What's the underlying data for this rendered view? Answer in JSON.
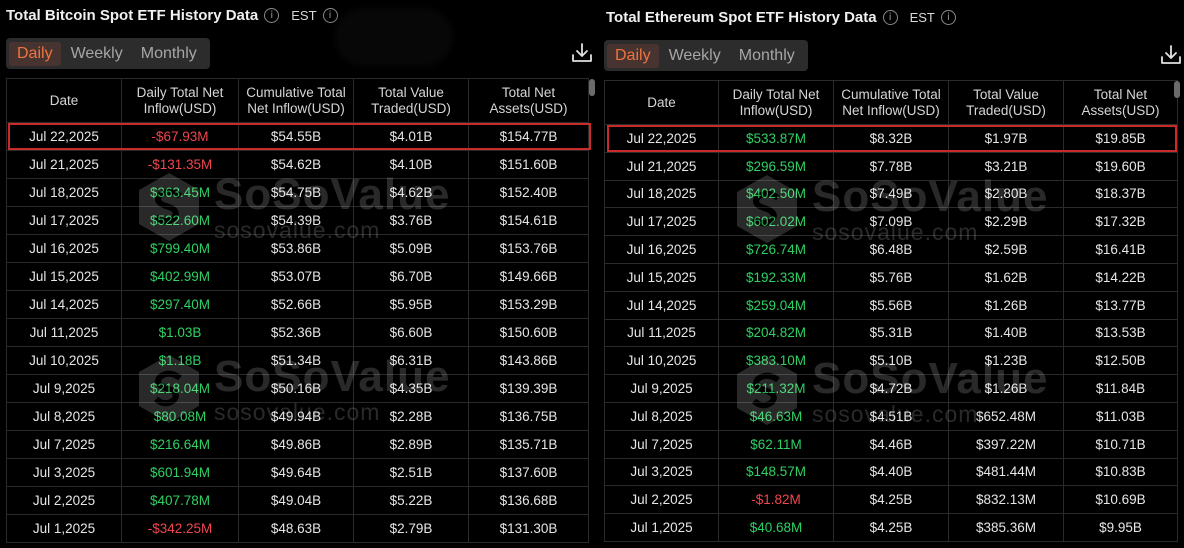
{
  "btc": {
    "title": "Total Bitcoin Spot ETF History Data",
    "timezone": "EST",
    "tabs": [
      "Daily",
      "Weekly",
      "Monthly"
    ],
    "active_tab": "Daily",
    "headers": [
      [
        "Date"
      ],
      [
        "Daily Total Net",
        "Inflow(USD)"
      ],
      [
        "Cumulative Total",
        "Net Inflow(USD)"
      ],
      [
        "Total Value",
        "Traded(USD)"
      ],
      [
        "Total Net",
        "Assets(USD)"
      ]
    ],
    "rows": [
      [
        "Jul 22,2025",
        "-$67.93M",
        "$54.55B",
        "$4.01B",
        "$154.77B"
      ],
      [
        "Jul 21,2025",
        "-$131.35M",
        "$54.62B",
        "$4.10B",
        "$151.60B"
      ],
      [
        "Jul 18,2025",
        "$363.45M",
        "$54.75B",
        "$4.62B",
        "$152.40B"
      ],
      [
        "Jul 17,2025",
        "$522.60M",
        "$54.39B",
        "$3.76B",
        "$154.61B"
      ],
      [
        "Jul 16,2025",
        "$799.40M",
        "$53.86B",
        "$5.09B",
        "$153.76B"
      ],
      [
        "Jul 15,2025",
        "$402.99M",
        "$53.07B",
        "$6.70B",
        "$149.66B"
      ],
      [
        "Jul 14,2025",
        "$297.40M",
        "$52.66B",
        "$5.95B",
        "$153.29B"
      ],
      [
        "Jul 11,2025",
        "$1.03B",
        "$52.36B",
        "$6.60B",
        "$150.60B"
      ],
      [
        "Jul 10,2025",
        "$1.18B",
        "$51.34B",
        "$6.31B",
        "$143.86B"
      ],
      [
        "Jul 9,2025",
        "$218.04M",
        "$50.16B",
        "$4.35B",
        "$139.39B"
      ],
      [
        "Jul 8,2025",
        "$80.08M",
        "$49.94B",
        "$2.28B",
        "$136.75B"
      ],
      [
        "Jul 7,2025",
        "$216.64M",
        "$49.86B",
        "$2.89B",
        "$135.71B"
      ],
      [
        "Jul 3,2025",
        "$601.94M",
        "$49.64B",
        "$2.51B",
        "$137.60B"
      ],
      [
        "Jul 2,2025",
        "$407.78M",
        "$49.04B",
        "$5.22B",
        "$136.68B"
      ],
      [
        "Jul 1,2025",
        "-$342.25M",
        "$48.63B",
        "$2.79B",
        "$131.30B"
      ]
    ]
  },
  "eth": {
    "title": "Total Ethereum Spot ETF History Data",
    "timezone": "EST",
    "tabs": [
      "Daily",
      "Weekly",
      "Monthly"
    ],
    "active_tab": "Daily",
    "headers": [
      [
        "Date"
      ],
      [
        "Daily Total Net",
        "Inflow(USD)"
      ],
      [
        "Cumulative Total",
        "Net Inflow(USD)"
      ],
      [
        "Total Value",
        "Traded(USD)"
      ],
      [
        "Total Net",
        "Assets(USD)"
      ]
    ],
    "rows": [
      [
        "Jul 22,2025",
        "$533.87M",
        "$8.32B",
        "$1.97B",
        "$19.85B"
      ],
      [
        "Jul 21,2025",
        "$296.59M",
        "$7.78B",
        "$3.21B",
        "$19.60B"
      ],
      [
        "Jul 18,2025",
        "$402.50M",
        "$7.49B",
        "$2.80B",
        "$18.37B"
      ],
      [
        "Jul 17,2025",
        "$602.02M",
        "$7.09B",
        "$2.29B",
        "$17.32B"
      ],
      [
        "Jul 16,2025",
        "$726.74M",
        "$6.48B",
        "$2.59B",
        "$16.41B"
      ],
      [
        "Jul 15,2025",
        "$192.33M",
        "$5.76B",
        "$1.62B",
        "$14.22B"
      ],
      [
        "Jul 14,2025",
        "$259.04M",
        "$5.56B",
        "$1.26B",
        "$13.77B"
      ],
      [
        "Jul 11,2025",
        "$204.82M",
        "$5.31B",
        "$1.40B",
        "$13.53B"
      ],
      [
        "Jul 10,2025",
        "$383.10M",
        "$5.10B",
        "$1.23B",
        "$12.50B"
      ],
      [
        "Jul 9,2025",
        "$211.32M",
        "$4.72B",
        "$1.26B",
        "$11.84B"
      ],
      [
        "Jul 8,2025",
        "$46.63M",
        "$4.51B",
        "$652.48M",
        "$11.03B"
      ],
      [
        "Jul 7,2025",
        "$62.11M",
        "$4.46B",
        "$397.22M",
        "$10.71B"
      ],
      [
        "Jul 3,2025",
        "$148.57M",
        "$4.40B",
        "$481.44M",
        "$10.83B"
      ],
      [
        "Jul 2,2025",
        "-$1.82M",
        "$4.25B",
        "$832.13M",
        "$10.69B"
      ],
      [
        "Jul 1,2025",
        "$40.68M",
        "$4.25B",
        "$385.36M",
        "$9.95B"
      ]
    ]
  },
  "watermark": {
    "brand": "SoSoValue",
    "url": "sosovalue.com"
  },
  "colors": {
    "positive": "#2fd063",
    "negative": "#f0464e",
    "accent": "#f0733f",
    "highlight_border": "#c92a2a"
  },
  "icons": {
    "info": "info-circle-icon",
    "download": "download-icon"
  }
}
